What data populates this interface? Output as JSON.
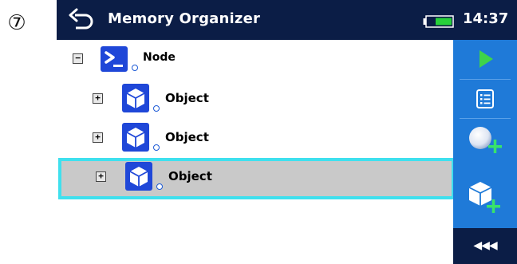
{
  "step_badge": "⑦",
  "header": {
    "title": "Memory Organizer",
    "time": "14:37"
  },
  "tree": {
    "node": {
      "label": "Node",
      "expander": "−",
      "icon": "node-terminal-icon"
    },
    "objects": [
      {
        "label": "Object",
        "expander": "+",
        "icon": "cube-icon",
        "selected": false
      },
      {
        "label": "Object",
        "expander": "+",
        "icon": "cube-icon",
        "selected": false
      },
      {
        "label": "Object",
        "expander": "+",
        "icon": "cube-icon",
        "selected": true
      }
    ]
  },
  "sidebar": {
    "buttons": [
      {
        "icon": "play-icon"
      },
      {
        "icon": "list-icon"
      },
      {
        "icon": "add-node-icon"
      },
      {
        "icon": "add-object-icon"
      }
    ],
    "more_label": "◀◀◀"
  },
  "colors": {
    "header_bg": "#0b1d46",
    "sidebar_bg": "#1f7ad8",
    "selection_border": "#3fe0ee",
    "selection_bg": "#c9c9c9",
    "play_green": "#3fd44a",
    "battery_green": "#27d13a",
    "icon_blue": "#1f47d8"
  }
}
